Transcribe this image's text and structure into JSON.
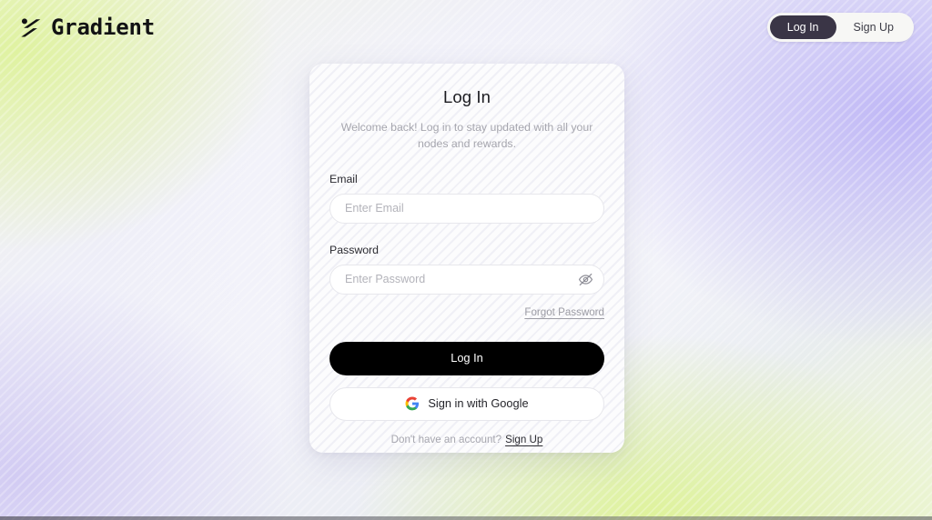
{
  "brand": {
    "name": "Gradient",
    "logo_icon": "gradient-slash-mark"
  },
  "header": {
    "tabs": [
      {
        "label": "Log In",
        "active": true
      },
      {
        "label": "Sign Up",
        "active": false
      }
    ]
  },
  "card": {
    "title": "Log In",
    "subtitle": "Welcome back! Log in to stay updated with all your nodes and rewards.",
    "email": {
      "label": "Email",
      "placeholder": "Enter Email",
      "value": ""
    },
    "password": {
      "label": "Password",
      "placeholder": "Enter Password",
      "value": "",
      "toggle_icon": "eye-off-icon"
    },
    "forgot_password": "Forgot Password",
    "submit_label": "Log In",
    "google_label": "Sign in with Google",
    "google_icon": "google-g-icon",
    "footer_prompt": "Don't have an account?",
    "footer_link": "Sign Up"
  },
  "colors": {
    "primary_button": "#000000",
    "active_tab": "#3a3546",
    "accent_green": "#ddf29a",
    "accent_purple": "#c4bdf2",
    "card_bg": "#fcfcfd",
    "muted_text": "#a6a6ae"
  }
}
